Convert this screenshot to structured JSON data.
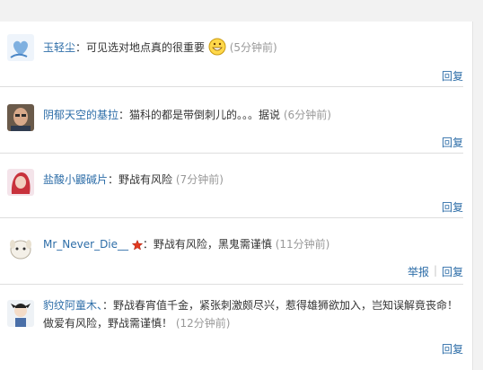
{
  "comments": [
    {
      "user": "玉轻尘",
      "text": "可见选对地点真的很重要",
      "time": "(5分钟前)",
      "reply": "回复",
      "emoji": "grinning-emoji-icon"
    },
    {
      "user": "阴郁天空的基拉",
      "text": "猫科的都是带倒刺儿的。。。据说",
      "time": "(6分钟前)",
      "reply": "回复"
    },
    {
      "user": "盐酸小鼹碱片",
      "text": "野战有风险",
      "time": "(7分钟前)",
      "reply": "回复"
    },
    {
      "user": "Mr_Never_Die__",
      "badge": "red-star-icon",
      "text": "野战有风险，黑鬼需谨慎",
      "time": "(11分钟前)",
      "report": "举报",
      "separator": "|",
      "reply": "回复"
    },
    {
      "user": "豹纹阿童木、",
      "text": "野战春宵值千金，紧张刺激颇尽兴，惹得雄狮欲加入，岂知误解竟丧命！",
      "text2": "做爱有风险，野战需谨慎！",
      "time": "(12分钟前)",
      "reply": "回复"
    }
  ],
  "colors": {
    "link": "#2e6ea8",
    "time": "#999999",
    "divider": "#dedede"
  }
}
